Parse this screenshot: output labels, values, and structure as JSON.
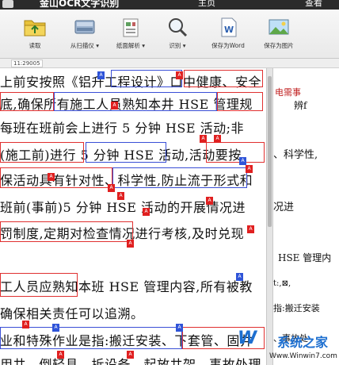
{
  "titlebar": {
    "app_title": "金山OCR文字识别",
    "tab_home": "主页",
    "tab_view": "查看"
  },
  "toolbar": {
    "read": "读取",
    "scan": "从扫描仪 ▾",
    "analyze": "纸面解析 ▾",
    "recognize": "识别 ▾",
    "save_word": "保存为Word",
    "save_image": "保存为图片"
  },
  "strip": {
    "page_no": "11:29005"
  },
  "document": {
    "lines": [
      "上前安按照《铝升工程设计》口中健康、安全",
      "底,确保所有施工人员熟知本井 HSE 管理规",
      "每班在班前会上进行 5 分钟 HSE 活动;非",
      "(施工前)进行 5 分钟 HSE 活动,活动要按",
      "保活动具有针对性、科学性,防止流于形式和",
      "班前(事前)5 分钟 HSE 活动的开展情况进",
      "罚制度,定期对检查情况进行考核,及时兑现",
      "",
      "",
      "工人员应熟知本班 HSE 管理内容,所有被教",
      "确保相关责任可以追溯。",
      "",
      "业和特殊作业是指:搬迁安装、下套管、固井",
      "用井、倒轻具、拆设备、起放井架、事故处理"
    ]
  },
  "result": {
    "lines": [
      "电需事",
      "辨f",
      "",
      "、科学性,",
      "况进",
      "",
      "",
      "HSE 管理内",
      "",
      "t:,⊠,",
      "指:搬迁安装",
      "、事故处"
    ]
  },
  "watermark": {
    "logo": "W",
    "brand": "系统之家",
    "url": "Www.Winwin7.com"
  },
  "colors": {
    "box_red": "#e03030",
    "box_blue": "#3a4fd6",
    "brand_blue": "#1d6fd0"
  }
}
